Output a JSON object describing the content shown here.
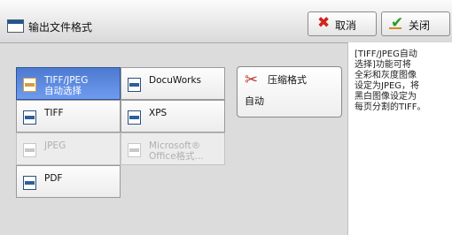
{
  "header": {
    "title": "输出文件格式",
    "cancel_label": "取消",
    "close_label": "关闭"
  },
  "formats": [
    {
      "label": "TIFF/JPEG\n自动选择",
      "selected": true,
      "enabled": true,
      "icon": "document-icon"
    },
    {
      "label": "DocuWorks",
      "selected": false,
      "enabled": true,
      "icon": "document-icon"
    },
    {
      "label": "TIFF",
      "selected": false,
      "enabled": true,
      "icon": "document-icon"
    },
    {
      "label": "XPS",
      "selected": false,
      "enabled": true,
      "icon": "document-icon"
    },
    {
      "label": "JPEG",
      "selected": false,
      "enabled": false,
      "icon": "document-icon"
    },
    {
      "label": "Microsoft®\nOffice格式...",
      "selected": false,
      "enabled": false,
      "icon": "office-icon"
    },
    {
      "label": "PDF",
      "selected": false,
      "enabled": true,
      "icon": "document-icon"
    }
  ],
  "compression": {
    "label": "压缩格式",
    "value": "自动"
  },
  "info_text": "[TIFF/JPEG自动\n选择]功能可将\n全彩和灰度图像\n设定为JPEG，将\n黑白图像设定为\n每页分割的TIFF。",
  "colors": {
    "selected": "#5a86dc",
    "background": "#dcdcdc"
  }
}
